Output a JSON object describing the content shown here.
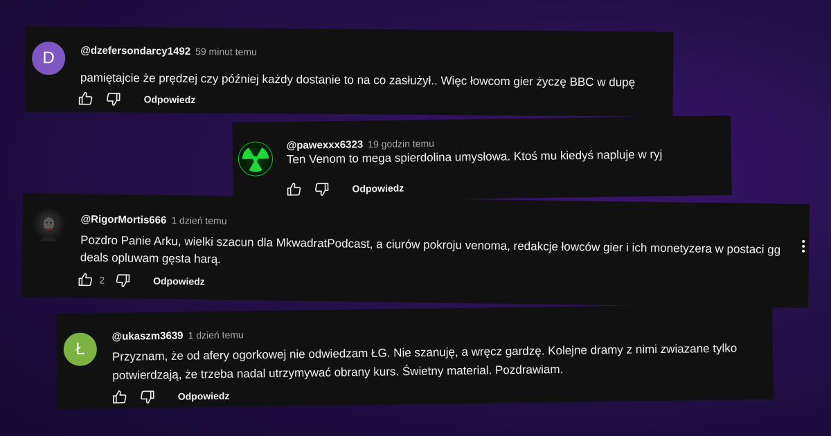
{
  "comments": [
    {
      "avatar_letter": "D",
      "avatar_color": "#7e57c2",
      "handle": "@dzefersondarcy1492",
      "time": "59 minut temu",
      "text": "pamiętajcie że prędzej czy później każdy dostanie to na co zasłużył.. Więc łowcom gier życzę BBC w dupę",
      "like_count": "",
      "reply_label": "Odpowiedz"
    },
    {
      "avatar_icon": "radiation-icon",
      "avatar_color": "#18c030",
      "handle": "@pawexxx6323",
      "time": "19 godzin temu",
      "text": "Ten Venom to mega spierdolina umysłowa. Ktoś mu kiedyś napluje w ryj",
      "like_count": "",
      "reply_label": "Odpowiedz"
    },
    {
      "avatar_icon": "dark-face-photo",
      "handle": "@RigorMortis666",
      "time": "1 dzień temu",
      "text": "Pozdro Panie Arku, wielki szacun dla MkwadratPodcast, a ciurów pokroju venoma, redakcje łowców gier i ich monetyzera w postaci gg deals opluwam gęsta harą.",
      "like_count": "2",
      "reply_label": "Odpowiedz"
    },
    {
      "avatar_letter": "Ł",
      "avatar_color": "#7cb342",
      "handle": "@ukaszm3639",
      "time": "1 dzień temu",
      "text": "Przyznam, że od afery ogorkowej nie odwiedzam ŁG. Nie szanuję, a wręcz gardzę. Kolejne dramy z nimi zwiazane tylko potwierdzają, że trzeba nadal utrzymywać obrany kurs. Świetny material. Pozdrawiam.",
      "like_count": "",
      "reply_label": "Odpowiedz"
    }
  ]
}
